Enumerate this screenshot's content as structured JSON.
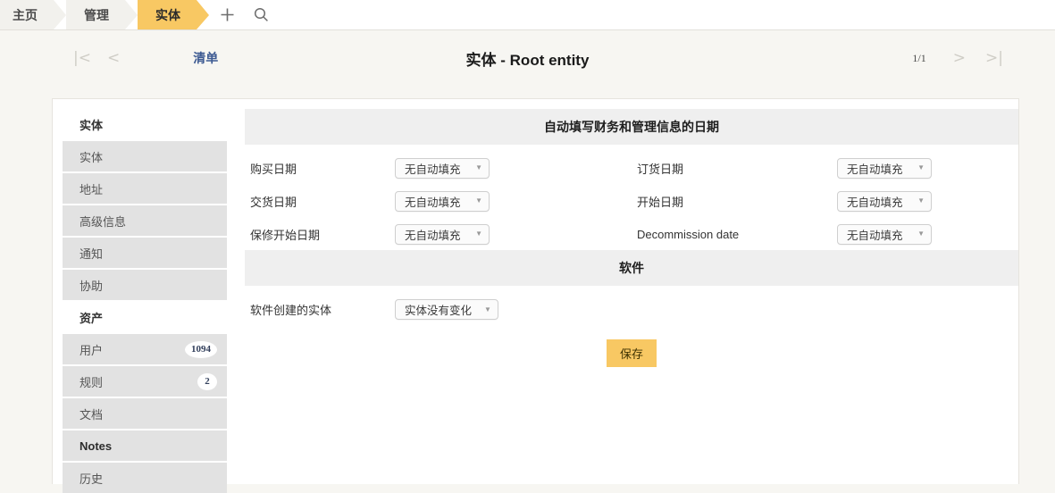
{
  "breadcrumb": {
    "items": [
      {
        "label": "主页",
        "active": false
      },
      {
        "label": "管理",
        "active": false
      },
      {
        "label": "实体",
        "active": true
      }
    ],
    "add_icon": "plus-icon",
    "search_icon": "search-icon"
  },
  "record_bar": {
    "first_arrow": "|<",
    "prev_arrow": "<",
    "list_link": "清单",
    "title": "实体 - Root entity",
    "page_indicator": "1/1",
    "next_arrow": ">",
    "last_arrow": ">|"
  },
  "sidebar": {
    "items": [
      {
        "label": "实体",
        "style": "header",
        "badge": ""
      },
      {
        "label": "实体",
        "style": "normal",
        "badge": ""
      },
      {
        "label": "地址",
        "style": "normal",
        "badge": ""
      },
      {
        "label": "高级信息",
        "style": "normal",
        "badge": ""
      },
      {
        "label": "通知",
        "style": "normal",
        "badge": ""
      },
      {
        "label": "协助",
        "style": "normal",
        "badge": ""
      },
      {
        "label": "资产",
        "style": "header",
        "badge": ""
      },
      {
        "label": "用户",
        "style": "normal",
        "badge": "1094"
      },
      {
        "label": "规则",
        "style": "normal",
        "badge": "2"
      },
      {
        "label": "文档",
        "style": "normal",
        "badge": ""
      },
      {
        "label": "Notes",
        "style": "strong",
        "badge": ""
      },
      {
        "label": "历史",
        "style": "normal",
        "badge": ""
      }
    ]
  },
  "main": {
    "dates_section": {
      "title": "自动填写财务和管理信息的日期",
      "left_fields": [
        {
          "label": "购买日期",
          "value": "无自动填充"
        },
        {
          "label": "交货日期",
          "value": "无自动填充"
        },
        {
          "label": "保修开始日期",
          "value": "无自动填充"
        }
      ],
      "right_fields": [
        {
          "label": "订货日期",
          "value": "无自动填充"
        },
        {
          "label": "开始日期",
          "value": "无自动填充"
        },
        {
          "label": "Decommission date",
          "value": "无自动填充"
        }
      ]
    },
    "software_section": {
      "title": "软件",
      "fields": [
        {
          "label": "软件创建的实体",
          "value": "实体没有变化"
        }
      ]
    },
    "save_label": "保存"
  },
  "colors": {
    "accent": "#f8c863",
    "link": "#3d5a92",
    "page_bg": "#f7f6f2",
    "panel_bg": "#ffffff",
    "sidebar_item_bg": "#e2e2e2",
    "section_head_bg": "#efefef"
  }
}
